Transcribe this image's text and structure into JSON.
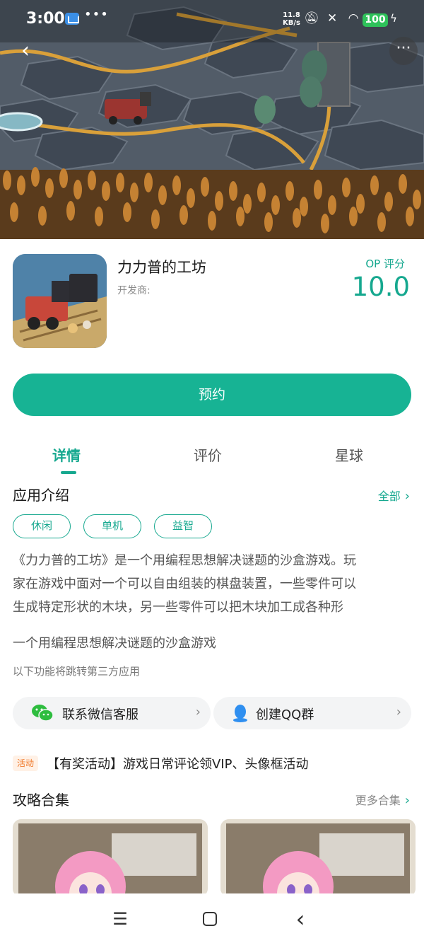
{
  "status_bar": {
    "time": "3:00",
    "dots": "•••",
    "speed_value": "11.8",
    "speed_unit": "KB/s",
    "battery": "100"
  },
  "header": {
    "back_icon": "chevron-left-icon",
    "more_icon": "more-dots-icon"
  },
  "app": {
    "title": "力力普的工坊",
    "developer_label": "开发商:",
    "score_label": "OP 评分",
    "score": "10.0"
  },
  "reserve_button": "预约",
  "tabs": [
    {
      "label": "详情",
      "active": true
    },
    {
      "label": "评价",
      "active": false
    },
    {
      "label": "星球",
      "active": false
    }
  ],
  "intro": {
    "title": "应用介绍",
    "more": "全部",
    "tags": [
      "休闲",
      "单机",
      "益智"
    ],
    "description_lines": [
      "《力力普的工坊》是一个用编程思想解决谜题的沙盒游戏。玩",
      "家在游戏中面对一个可以自由组装的棋盘装置，一些零件可以",
      "生成特定形状的木块，另一些零件可以把木块加工成各种形"
    ],
    "subtitle": "一个用编程思想解决谜题的沙盒游戏",
    "third_party_note": "以下功能将跳转第三方应用"
  },
  "contacts": [
    {
      "label": "联系微信客服",
      "icon": "wechat-icon",
      "color": "#2ebd3f"
    },
    {
      "label": "创建QQ群",
      "icon": "qq-icon",
      "color": "#2f8ff0"
    }
  ],
  "activity": {
    "badge": "活动",
    "text": "【有奖活动】游戏日常评论领VIP、头像框活动"
  },
  "guides": {
    "title": "攻略合集",
    "more": "更多合集"
  },
  "colors": {
    "accent": "#17b394",
    "accent_text": "#16a88f",
    "activity_orange": "#f07a2c"
  }
}
